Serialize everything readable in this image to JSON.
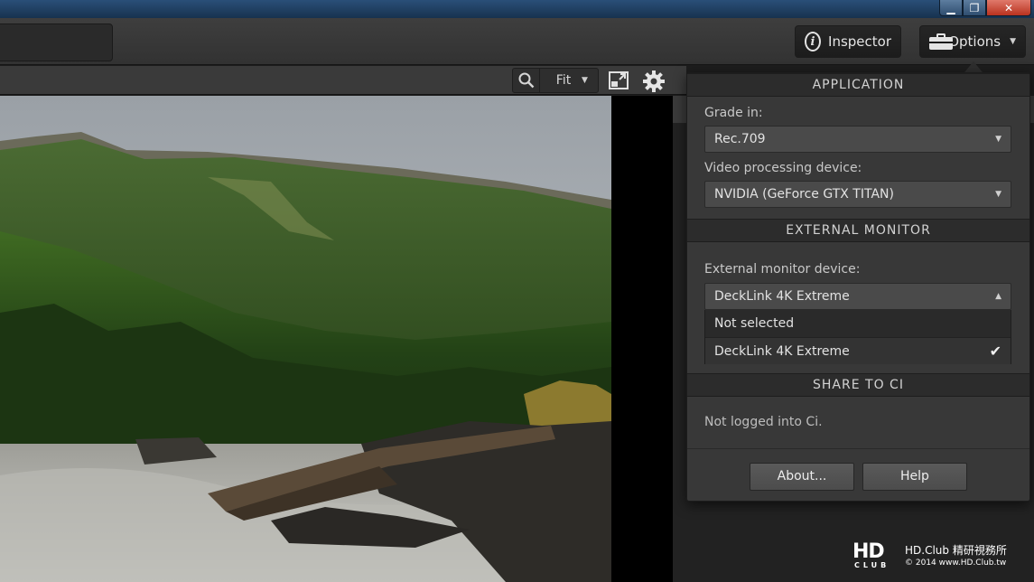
{
  "window": {
    "minimize_glyph": "▁",
    "maximize_glyph": "❐",
    "close_glyph": "✕"
  },
  "toolbar": {
    "inspector_label": "Inspector",
    "inspector_icon": "info-icon",
    "options_label": "Options",
    "options_icon": "briefcase-icon"
  },
  "viewer": {
    "zoom_value": "Fit",
    "icons": [
      "search-icon",
      "fit-to-window-icon",
      "gear-icon"
    ]
  },
  "options_panel": {
    "application": {
      "header": "APPLICATION",
      "grade_label": "Grade in:",
      "grade_value": "Rec.709",
      "device_label": "Video processing device:",
      "device_value": "NVIDIA (GeForce GTX TITAN)"
    },
    "external_monitor": {
      "header": "EXTERNAL MONITOR",
      "device_label": "External monitor device:",
      "device_value": "DeckLink 4K Extreme",
      "options": [
        {
          "label": "Not selected",
          "selected": false
        },
        {
          "label": "DeckLink 4K Extreme",
          "selected": true
        }
      ]
    },
    "share": {
      "header": "SHARE TO CI",
      "status": "Not logged into Ci."
    },
    "about_label": "About...",
    "help_label": "Help"
  },
  "watermark": {
    "logo": "HD",
    "logo_sub": "CLUB",
    "line1": "HD.Club 精研視務所",
    "line2": "© 2014  www.HD.Club.tw"
  },
  "colors": {
    "panel_bg": "#383838",
    "header_bg": "#2c2c2c",
    "titlebar": "#1f3d5e",
    "close_button": "#c7432f"
  }
}
